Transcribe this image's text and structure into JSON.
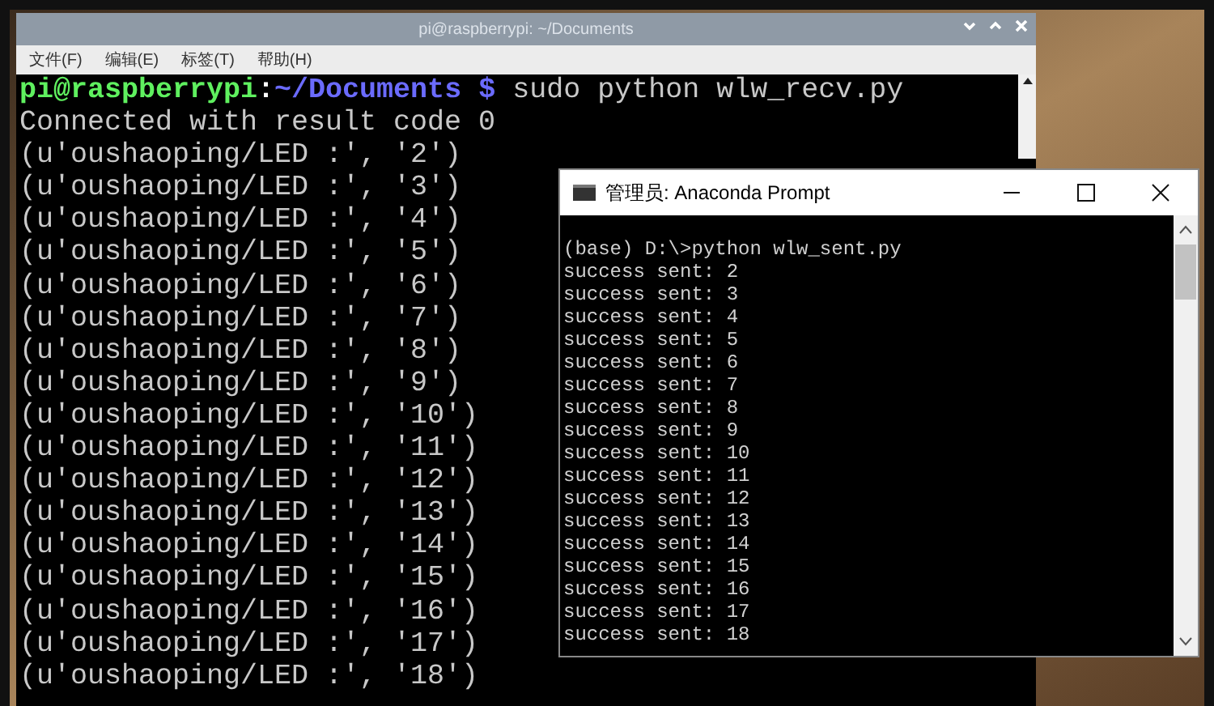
{
  "pi_terminal": {
    "title": "pi@raspberrypi: ~/Documents",
    "menu": [
      "文件(F)",
      "编辑(E)",
      "标签(T)",
      "帮助(H)"
    ],
    "prompt": {
      "user_host": "pi@raspberrypi",
      "separator": ":",
      "path": "~/Documents $",
      "command": " sudo python wlw_recv.py"
    },
    "lines": [
      "Connected with result code 0",
      "(u'oushaoping/LED :', '2')",
      "(u'oushaoping/LED :', '3')",
      "(u'oushaoping/LED :', '4')",
      "(u'oushaoping/LED :', '5')",
      "(u'oushaoping/LED :', '6')",
      "(u'oushaoping/LED :', '7')",
      "(u'oushaoping/LED :', '8')",
      "(u'oushaoping/LED :', '9')",
      "(u'oushaoping/LED :', '10')",
      "(u'oushaoping/LED :', '11')",
      "(u'oushaoping/LED :', '12')",
      "(u'oushaoping/LED :', '13')",
      "(u'oushaoping/LED :', '14')",
      "(u'oushaoping/LED :', '15')",
      "(u'oushaoping/LED :', '16')",
      "(u'oushaoping/LED :', '17')",
      "(u'oushaoping/LED :', '18')"
    ]
  },
  "anaconda_prompt": {
    "title": "管理员: Anaconda Prompt",
    "lines": [
      "(base) D:\\>python wlw_sent.py",
      "success sent: 2",
      "success sent: 3",
      "success sent: 4",
      "success sent: 5",
      "success sent: 6",
      "success sent: 7",
      "success sent: 8",
      "success sent: 9",
      "success sent: 10",
      "success sent: 11",
      "success sent: 12",
      "success sent: 13",
      "success sent: 14",
      "success sent: 15",
      "success sent: 16",
      "success sent: 17",
      "success sent: 18"
    ]
  }
}
